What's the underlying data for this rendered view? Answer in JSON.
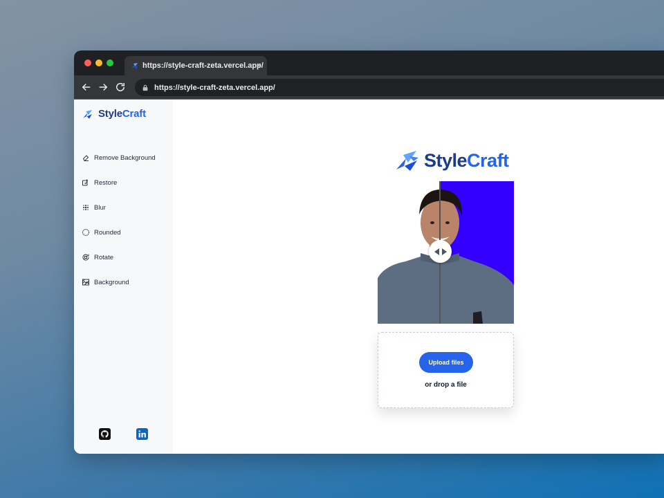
{
  "browser": {
    "tab_title": "https://style-craft-zeta.vercel.app/",
    "url": "https://style-craft-zeta.vercel.app/"
  },
  "brand": {
    "name_part1": "Style",
    "name_part2": "Craft",
    "primary_color": "#1e3a8a",
    "accent_color": "#2563eb"
  },
  "sidebar": {
    "items": [
      {
        "label": "Remove Background",
        "icon": "eraser-icon"
      },
      {
        "label": "Restore",
        "icon": "restore-icon"
      },
      {
        "label": "Blur",
        "icon": "blur-icon"
      },
      {
        "label": "Rounded",
        "icon": "circle-icon"
      },
      {
        "label": "Rotate",
        "icon": "rotate-icon"
      },
      {
        "label": "Background",
        "icon": "background-icon"
      }
    ],
    "socials": [
      {
        "name": "github-icon"
      },
      {
        "name": "linkedin-icon"
      }
    ]
  },
  "preview": {
    "after_background_color": "#3300ff"
  },
  "upload": {
    "button_label": "Upload files",
    "drop_text": "or drop a file"
  }
}
